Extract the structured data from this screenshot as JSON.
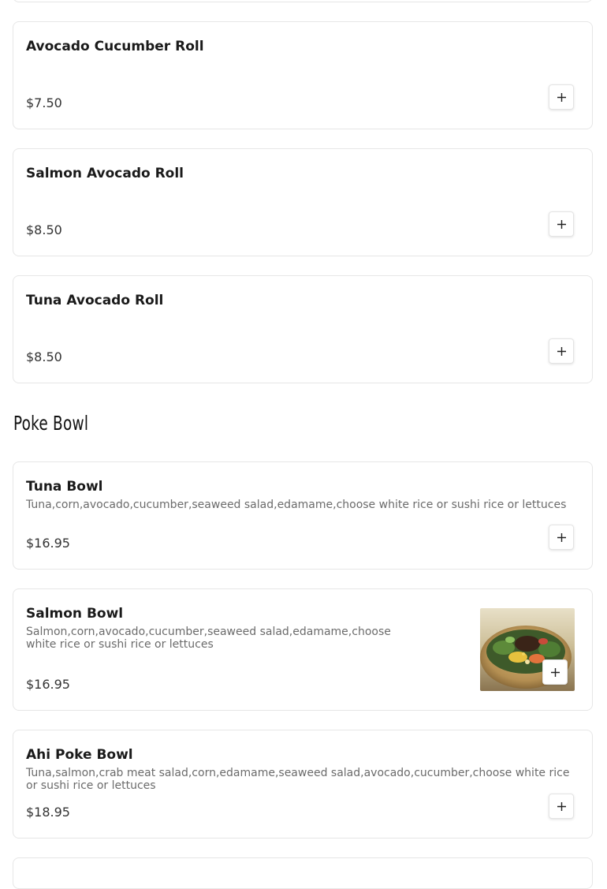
{
  "rolls": [
    {
      "name": "Avocado Cucumber Roll",
      "price": "$7.50"
    },
    {
      "name": "Salmon Avocado Roll",
      "price": "$8.50"
    },
    {
      "name": "Tuna Avocado Roll",
      "price": "$8.50"
    }
  ],
  "poke_section": {
    "title": "Poke Bowl",
    "items": [
      {
        "name": "Tuna Bowl",
        "description": "Tuna,corn,avocado,cucumber,seaweed salad,edamame,choose white rice or sushi rice or lettuces",
        "price": "$16.95"
      },
      {
        "name": "Salmon Bowl",
        "description": "Salmon,corn,avocado,cucumber,seaweed salad,edamame,choose white rice or sushi rice or lettuces",
        "price": "$16.95"
      },
      {
        "name": "Ahi Poke Bowl",
        "description": "Tuna,salmon,crab meat salad,corn,edamame,seaweed salad,avocado,cucumber,choose white rice or sushi rice or lettuces",
        "price": "$18.95"
      }
    ]
  },
  "icons": {
    "add": "plus-icon",
    "photo": "salmon-bowl-photo"
  },
  "colors": {
    "border": "#e6e6e6",
    "text": "#1a1a1a",
    "muted": "#6b6b6b"
  }
}
